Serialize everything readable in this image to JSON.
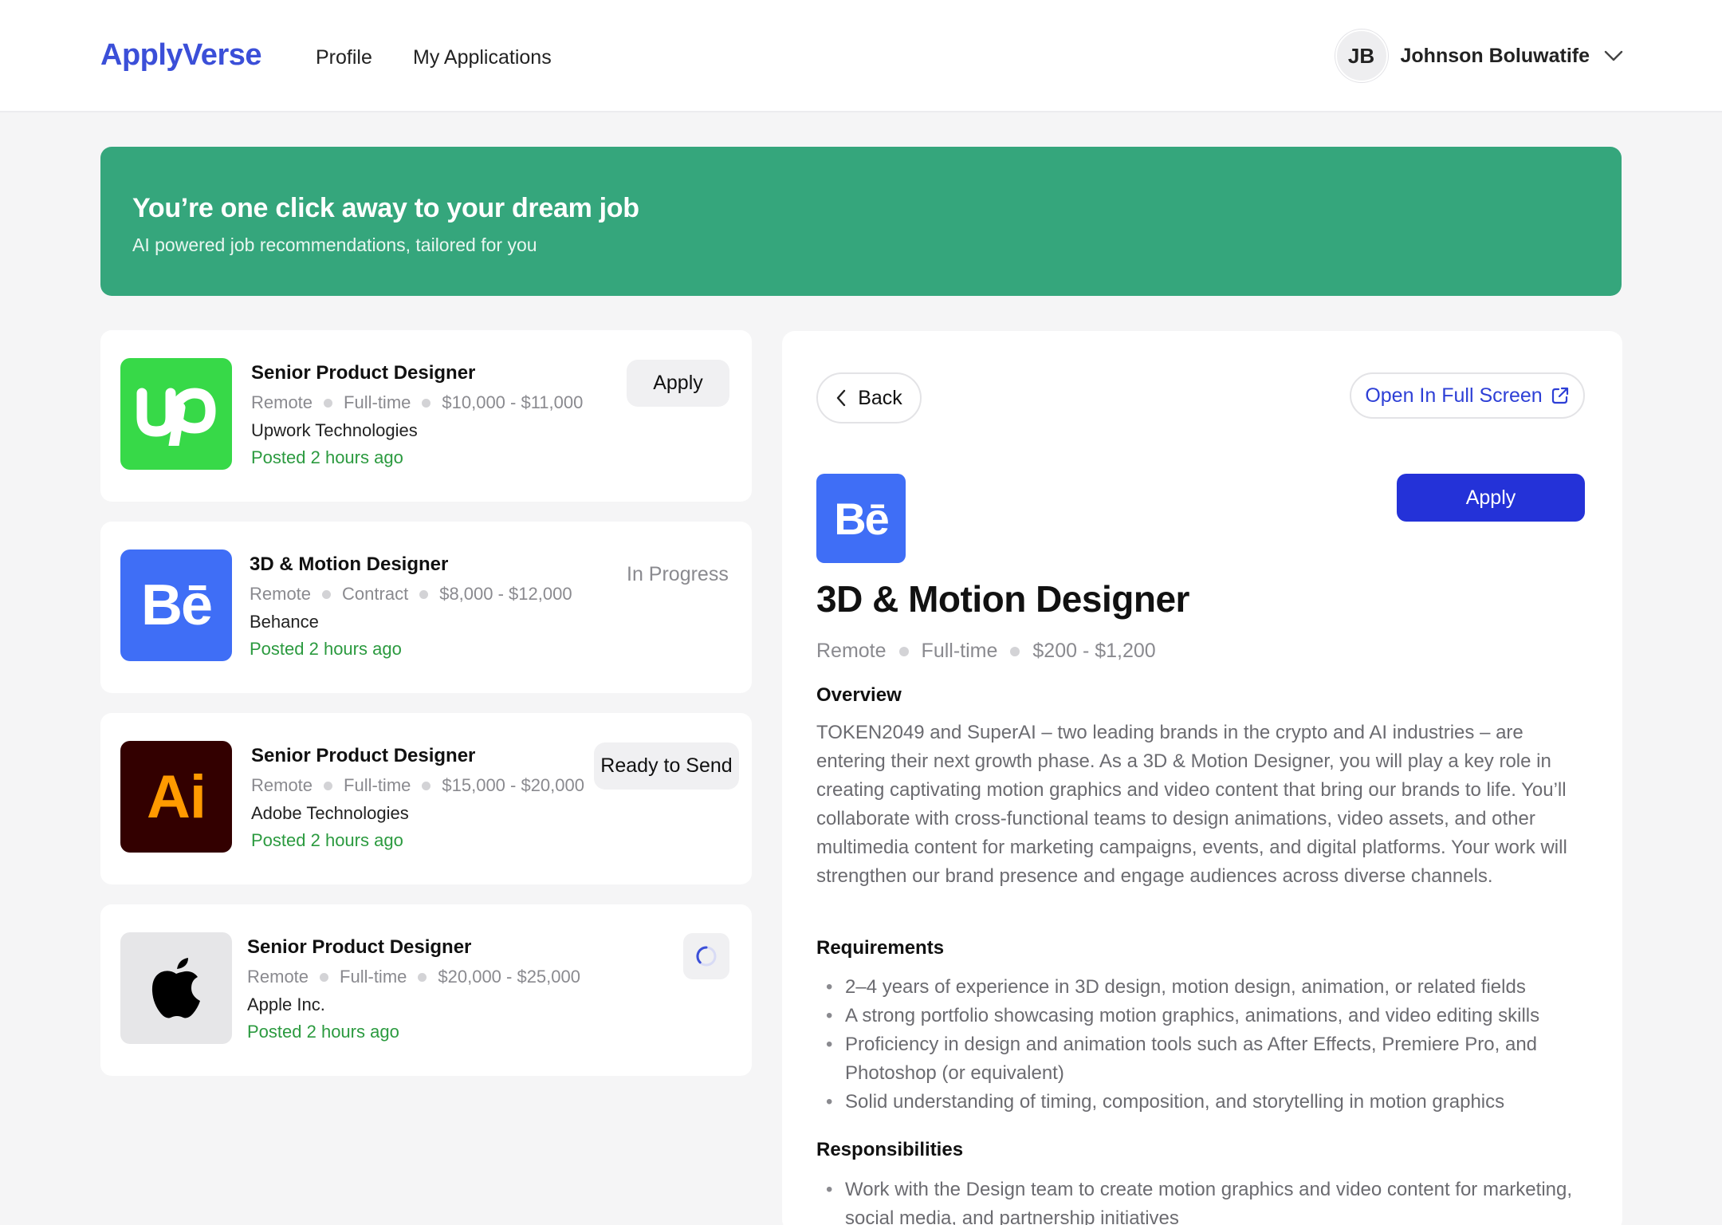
{
  "header": {
    "brand": "ApplyVerse",
    "nav": [
      "Profile",
      "My Applications"
    ],
    "user": {
      "initials": "JB",
      "name": "Johnson Boluwatife"
    }
  },
  "banner": {
    "title": "You’re one click away to your dream job",
    "subtitle": "AI powered job recommendations, tailored for you"
  },
  "jobs": [
    {
      "title": "Senior Product Designer",
      "location": "Remote",
      "type": "Full-time",
      "salary": "$10,000 - $11,000",
      "company": "Upwork Technologies",
      "posted": "Posted 2 hours ago",
      "action": "Apply",
      "logo": "upwork-logo"
    },
    {
      "title": "3D & Motion Designer",
      "location": "Remote",
      "type": "Contract",
      "salary": "$8,000 - $12,000",
      "company": "Behance",
      "posted": "Posted 2 hours ago",
      "action": "In Progress",
      "logo": "behance-logo"
    },
    {
      "title": "Senior Product Designer",
      "location": "Remote",
      "type": "Full-time",
      "salary": "$15,000 - $20,000",
      "company": "Adobe Technologies",
      "posted": "Posted 2 hours ago",
      "action": "Ready to Send",
      "logo": "adobe-illustrator-logo"
    },
    {
      "title": "Senior Product Designer",
      "location": "Remote",
      "type": "Full-time",
      "salary": "$20,000 - $25,000",
      "company": "Apple Inc.",
      "posted": "Posted 2 hours ago",
      "action": "",
      "logo": "apple-logo"
    }
  ],
  "detail": {
    "back": "Back",
    "fullscreen": "Open In Full Screen",
    "apply": "Apply",
    "logo_text": "Bē",
    "title": "3D & Motion Designer",
    "location": "Remote",
    "type": "Full-time",
    "salary": "$200 - $1,200",
    "overview_heading": "Overview",
    "overview": "TOKEN2049 and SuperAI – two leading brands in the crypto and AI industries – are entering their next growth phase. As a 3D & Motion Designer, you will play a key role in creating captivating motion graphics and video content that bring our brands to life. You’ll collaborate with cross-functional teams to design animations, video assets, and other multimedia content for marketing campaigns, events, and digital platforms. Your work will strengthen our brand presence and engage audiences across diverse channels.",
    "requirements_heading": "Requirements",
    "requirements": [
      "2–4 years of experience in 3D design, motion design, animation, or related fields",
      "A strong portfolio showcasing motion graphics, animations, and video editing skills",
      "Proficiency in design and animation tools such as After Effects, Premiere Pro, and Photoshop (or equivalent)",
      "Solid understanding of timing, composition, and storytelling in motion graphics"
    ],
    "responsibilities_heading": "Responsibilities",
    "responsibilities": [
      "Work with the Design team to create motion graphics and video content for marketing, social media, and partnership initiatives"
    ]
  },
  "colors": {
    "brand": "#3b4fd8",
    "banner": "#35a67c",
    "primary_button": "#2432d8",
    "posted_green": "#2b9a3f",
    "upwork": "#37d948",
    "behance": "#3f6ef6",
    "illustrator_bg": "#330000",
    "illustrator_fg": "#ff9a00"
  }
}
